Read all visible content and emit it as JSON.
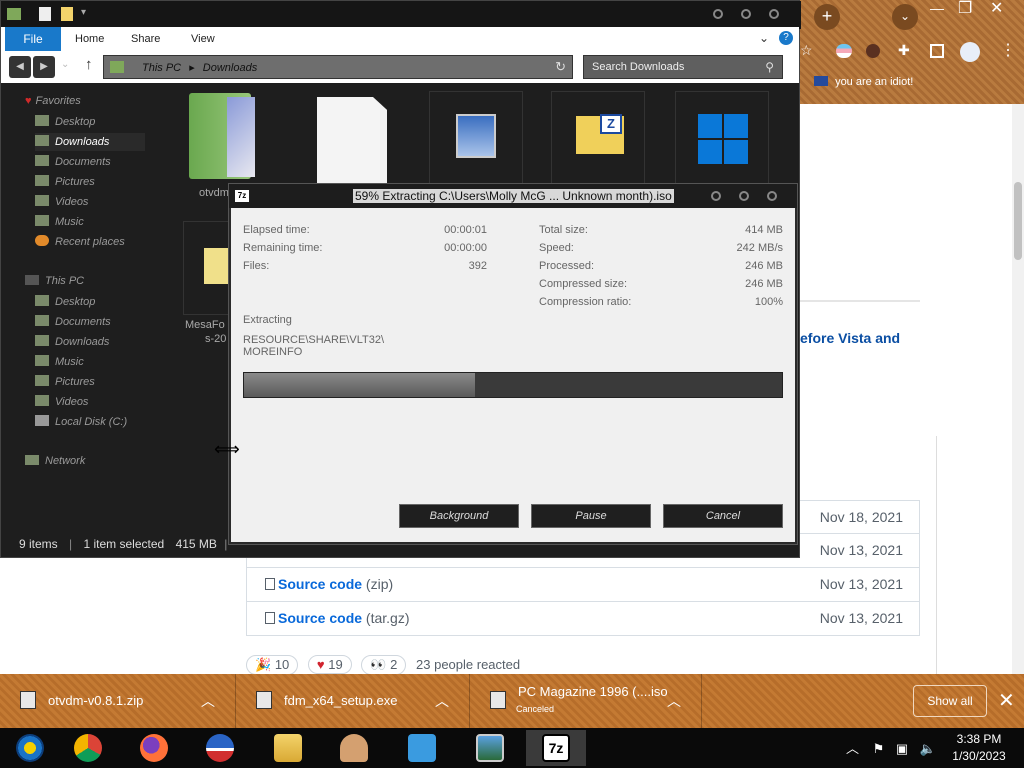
{
  "browser": {
    "bookmark": "you are an idiot!",
    "headline_fragment": "efore Vista and",
    "assets": [
      {
        "date": "Nov 18, 2021"
      },
      {
        "date": "Nov 13, 2021"
      },
      {
        "label": "Source code",
        "ext": "(zip)",
        "date": "Nov 13, 2021"
      },
      {
        "label": "Source code",
        "ext": "(tar.gz)",
        "date": "Nov 13, 2021"
      }
    ],
    "reactions": {
      "tada": "10",
      "heart": "19",
      "eyes": "2",
      "summary": "23 people reacted"
    }
  },
  "downloads": {
    "items": [
      {
        "name": "otvdm-v0.8.1.zip",
        "status": ""
      },
      {
        "name": "fdm_x64_setup.exe",
        "status": ""
      },
      {
        "name": "PC Magazine 1996 (....iso",
        "status": "Canceled"
      }
    ],
    "show_all": "Show all"
  },
  "taskbar": {
    "time": "3:38 PM",
    "date": "1/30/2023"
  },
  "explorer": {
    "ribbon": {
      "file": "File",
      "home": "Home",
      "share": "Share",
      "view": "View"
    },
    "address": {
      "this_pc": "This PC",
      "folder": "Downloads"
    },
    "search_placeholder": "Search Downloads",
    "nav": {
      "favorites": "Favorites",
      "fav_items": [
        "Desktop",
        "Downloads",
        "Documents",
        "Pictures",
        "Videos",
        "Music",
        "Recent places"
      ],
      "this_pc": "This PC",
      "pc_items": [
        "Desktop",
        "Documents",
        "Downloads",
        "Music",
        "Pictures",
        "Videos",
        "Local Disk (C:)"
      ],
      "network": "Network"
    },
    "files": {
      "f1": "otvdm",
      "f2": "MesaFo",
      "f2b": "s-20"
    },
    "status": {
      "count": "9 items",
      "selected": "1 item selected",
      "size": "415 MB"
    }
  },
  "dialog": {
    "title": "59% Extracting C:\\Users\\Molly McG ... Unknown month).iso",
    "left": [
      {
        "label": "Elapsed time:",
        "value": "00:00:01"
      },
      {
        "label": "Remaining time:",
        "value": "00:00:00"
      },
      {
        "label": "Files:",
        "value": "392"
      }
    ],
    "right": [
      {
        "label": "Total size:",
        "value": "414 MB"
      },
      {
        "label": "Speed:",
        "value": "242 MB/s"
      },
      {
        "label": "Processed:",
        "value": "246 MB"
      },
      {
        "label": "Compressed size:",
        "value": "246 MB"
      },
      {
        "label": "Compression ratio:",
        "value": "100%"
      }
    ],
    "extracting_label": "Extracting",
    "path_line1": "RESOURCE\\SHARE\\VLT32\\",
    "path_line2": "MOREINFO",
    "progress_fraction": 0.43,
    "buttons": {
      "background": "Background",
      "pause": "Pause",
      "cancel": "Cancel"
    }
  }
}
